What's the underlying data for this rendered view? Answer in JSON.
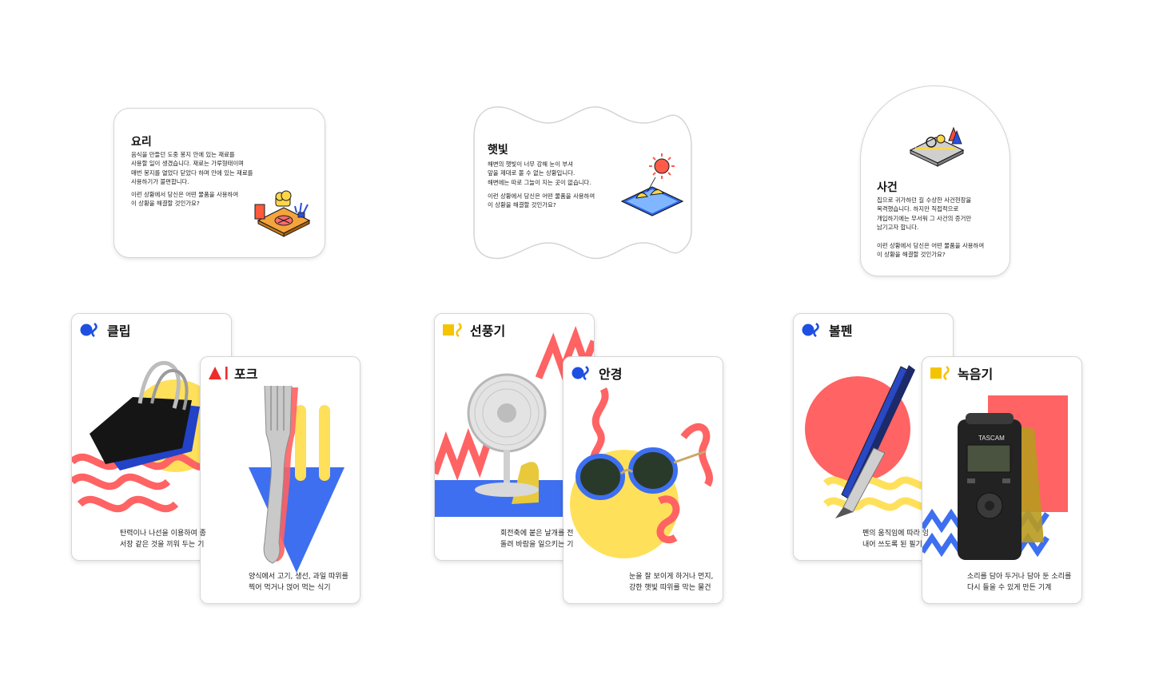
{
  "situation_cards": [
    {
      "title": "요리",
      "body": "음식을 만들던 도중 봉지 안에 있는 재료를\n사용할 일이 생겼습니다. 재료는 가루형태이며\n매번 봉지를 열었다 닫았다 하며 안에 있는 재료를\n사용하기가 불편합니다.",
      "question": "이런 상황에서 당신은 어떤 물품을 사용하여\n이 상황을 해결할 것인가요?",
      "illustration": "cooking-table-icon"
    },
    {
      "title": "햇빛",
      "body": "해변의 햇빛이 너무 강해 눈이 부셔\n앞을 제대로 볼 수 없는 상황입니다.\n해변에는 따로 그늘이 지는 곳이 없습니다.",
      "question": "이런 상황에서 당신은 어떤 물품을 사용하여\n이 상황을 해결할 것인가요?",
      "illustration": "beach-sun-icon"
    },
    {
      "title": "사건",
      "body": "집으로 귀가하던 길 수상한 사건현장을\n목격했습니다. 하지만 직접적으로\n개입하기에는 무서워 그 사건의 증거만\n남기고자 합니다.",
      "question": "이런 상황에서 당신은 어떤 물품을 사용하여\n이 상황을 해결할 것인가요?",
      "illustration": "crime-scene-icon"
    }
  ],
  "object_cards": [
    {
      "name": "클립",
      "description": "탄력이나 나선을 이용하여 종\n서장 같은 것을 끼워 두는 기",
      "shape_code": "circle-squiggle",
      "accent": "#1f4fe0"
    },
    {
      "name": "포크",
      "description": "양식에서 고기, 생선, 과일 따위를\n찍어 먹거나 얹어 먹는 식기",
      "shape_code": "triangle-line",
      "accent": "#ee2b2b"
    },
    {
      "name": "선풍기",
      "description": "회전축에 붙은 날개를 전\n돌려 바람을 일으키는 기",
      "shape_code": "square-squiggle",
      "accent": "#f5c400"
    },
    {
      "name": "안경",
      "description": "눈을 잘 보이게 하거나 먼지,\n강한 햇빛 따위를 막는 물건",
      "shape_code": "circle-squiggle",
      "accent": "#1f4fe0"
    },
    {
      "name": "볼펜",
      "description": "펜의 움직임에 따라 잉\n내어 쓰도록 된 필기",
      "shape_code": "circle-squiggle",
      "accent": "#1f4fe0"
    },
    {
      "name": "녹음기",
      "description": "소리를 담아 두거나 담아 둔 소리를\n다시 들을 수 있게 만든 기계",
      "shape_code": "square-squiggle",
      "accent": "#f5c400"
    }
  ],
  "device_label": "TASCAM",
  "colors": {
    "blue": "#3d6ff0",
    "red": "#ff6161",
    "yellow": "#ffe05a",
    "mustard": "#e9c93c",
    "border": "#d4d4d4"
  }
}
